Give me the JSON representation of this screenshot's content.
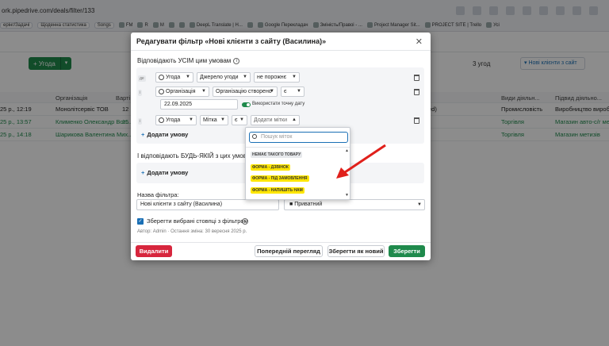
{
  "browser": {
    "url": "ork.pipedrive.com/deals/filter/133",
    "bookmarks": [
      "ерінг/Задачі",
      "Щоденна статистика",
      "Songs",
      "FM",
      "R",
      "M",
      "",
      "",
      "DeepL Translate | Н...",
      "",
      "Google Перекладач",
      "Зміність/Правоі - ...",
      "Project Manager Sit...",
      "PROJECT SITE | Trello",
      "Усі"
    ]
  },
  "toolbar": {
    "add_deal_label": "Угода",
    "deals_count": "3 угод",
    "filter_label": "Нові клієнти з сайт"
  },
  "grid": {
    "headers": [
      "",
      "Організація",
      "Варті",
      "",
      "Види діяльн...",
      "Підвид діяльно..."
    ],
    "rows": [
      {
        "date": "25 р., 12:19",
        "org": "Монолітсервіс ТОВ",
        "val": "12",
        "mid": "ed)",
        "kind": "Промисловість",
        "sub": "Виробництво виробів"
      },
      {
        "date": "25 р., 13:57",
        "org": "Клименко Олександр Вол...",
        "val": "15",
        "mid": "",
        "kind": "Торгівля",
        "sub": "Магазин авто-с/г мет"
      },
      {
        "date": "25 р., 14:18",
        "org": "Шарикова Валентина Мих...",
        "val": "",
        "mid": "",
        "kind": "Торгівля",
        "sub": "Магазин метизів"
      }
    ]
  },
  "modal": {
    "title": "Редагувати фільтр «Нові клієнти з сайту (Василина)»",
    "all_conditions_label": "Відповідають УСІМ цим умовам",
    "conditions": [
      {
        "tag": "де",
        "entity": "Угода",
        "field": "Джерело угоди",
        "operator": "не порожнє"
      },
      {
        "tag": "і",
        "entity": "Організація",
        "field": "Організацію створено",
        "operator": "є",
        "date_value": "22.09.2025",
        "toggle_label": "Використати точну дату"
      },
      {
        "tag": "і",
        "entity": "Угода",
        "field": "Мітка",
        "operator": "є",
        "value_placeholder": "Додати мітки"
      }
    ],
    "add_condition_label": "Додати умову",
    "any_conditions_label": "І відповідають БУДЬ-ЯКІЙ з цих умов",
    "filter_name_label": "Назва фільтра:",
    "filter_name_value": "Нові клієнти з сайту (Василина)",
    "visibility_value": "Приватний",
    "save_columns_label": "Зберегти вибрані стовпці з фільтром",
    "meta": "Автор: Admin · Остання зміна: 30 вересня 2025 р.",
    "buttons": {
      "delete": "Видалити",
      "preview": "Попередній перегляд",
      "save_as_new": "Зберегти як новий",
      "save": "Зберегти"
    }
  },
  "dropdown": {
    "search_placeholder": "Пошук міток",
    "items": [
      {
        "label": "НЕМАЄ ТАКОГО ТОВАРУ",
        "bg": "#e6e8eb",
        "fg": "#444"
      },
      {
        "label": "ФОРМА - ДЗВІНОК",
        "bg": "#ffe600",
        "fg": "#333"
      },
      {
        "label": "ФОРМА - ПІД ЗАМОВЛЕННЯ",
        "bg": "#ffe600",
        "fg": "#333"
      },
      {
        "label": "ФОРМА - НАПИШІТЬ НАМ",
        "bg": "#ffe600",
        "fg": "#333"
      }
    ]
  },
  "colors": {
    "accent_green": "#1f8a4c",
    "delete_red": "#d7263d",
    "arrow_red": "#e0201b",
    "link_blue": "#1a6fb5"
  }
}
